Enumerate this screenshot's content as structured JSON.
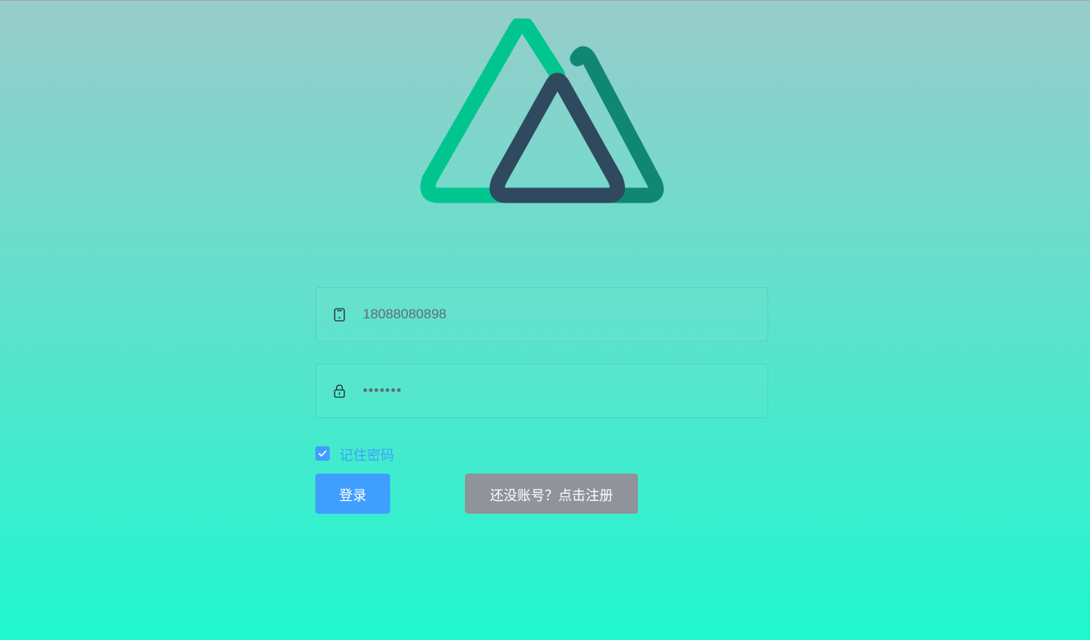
{
  "logo": {
    "icon": "nuxt-logo-icon"
  },
  "form": {
    "phone": {
      "value": "18088080898",
      "icon": "mobile-phone-icon"
    },
    "password": {
      "value": "•••••••",
      "icon": "lock-icon"
    },
    "remember": {
      "label": "记住密码",
      "checked": true
    },
    "login_label": "登录",
    "register_label": "还没账号？点击注册"
  },
  "colors": {
    "primary": "#409eff",
    "info": "#909399",
    "logo_green": "#00c58e",
    "logo_dark_green": "#108775",
    "logo_navy": "#2f495e"
  }
}
